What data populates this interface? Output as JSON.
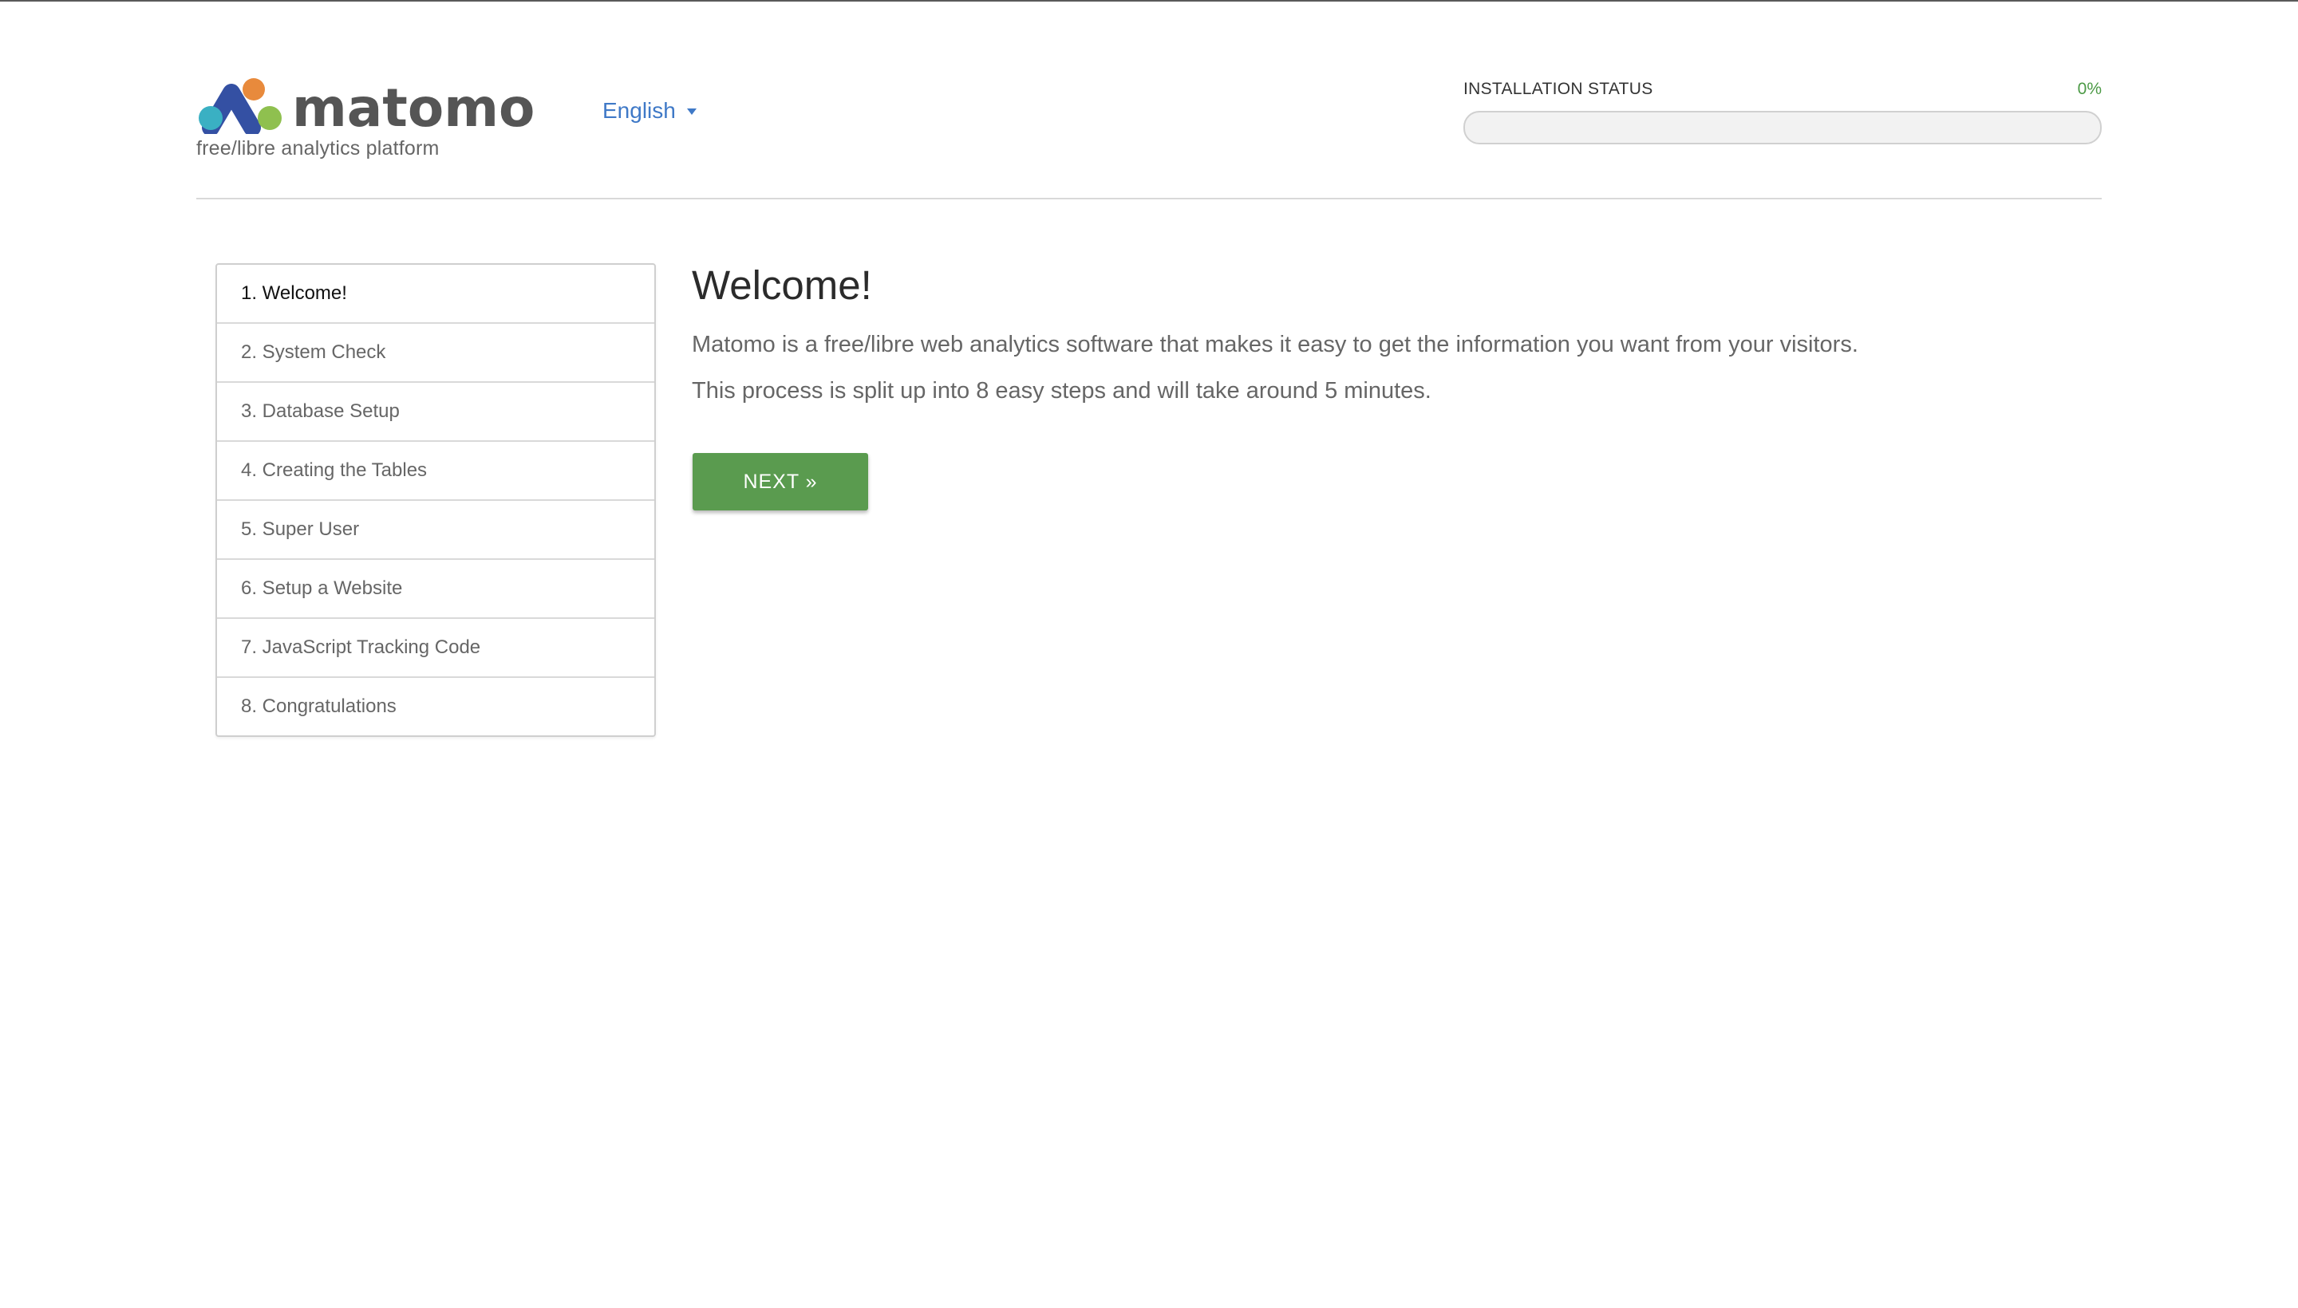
{
  "header": {
    "logo_text": "matomo",
    "tagline": "free/libre analytics platform",
    "language": "English"
  },
  "installation_status": {
    "label": "INSTALLATION STATUS",
    "percent_text": "0%",
    "progress_fraction": 0
  },
  "steps": [
    {
      "label": "1. Welcome!",
      "active": true
    },
    {
      "label": "2. System Check",
      "active": false
    },
    {
      "label": "3. Database Setup",
      "active": false
    },
    {
      "label": "4. Creating the Tables",
      "active": false
    },
    {
      "label": "5. Super User",
      "active": false
    },
    {
      "label": "6. Setup a Website",
      "active": false
    },
    {
      "label": "7. JavaScript Tracking Code",
      "active": false
    },
    {
      "label": "8. Congratulations",
      "active": false
    }
  ],
  "main": {
    "title": "Welcome!",
    "paragraph_1": "Matomo is a free/libre web analytics software that makes it easy to get the information you want from your visitors.",
    "paragraph_2": "This process is split up into 8 easy steps and will take around 5 minutes.",
    "next_label": "NEXT »"
  },
  "colors": {
    "accent_green": "#5a9b4f",
    "link_blue": "#3f79c7",
    "logo_blue": "#3450a3",
    "logo_teal": "#3ab0c3",
    "logo_orange": "#e88a3c",
    "logo_green": "#8fc04f",
    "logo_text": "#555555"
  },
  "icons": {
    "logo_mark": "matomo-logo-icon",
    "language_caret": "caret-down-icon"
  }
}
